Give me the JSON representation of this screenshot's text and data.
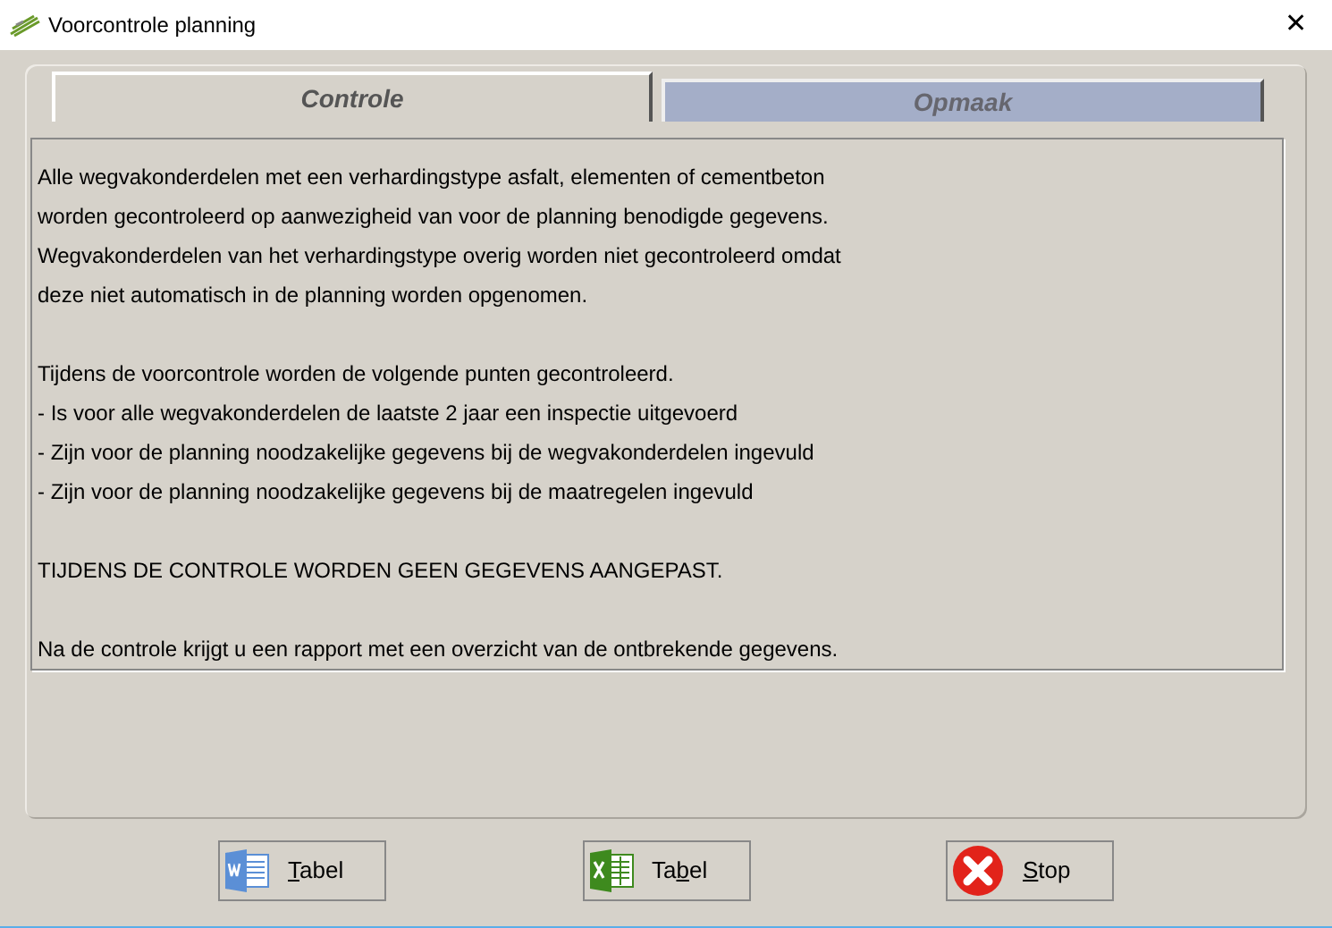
{
  "window": {
    "title": "Voorcontrole planning",
    "close": "✕"
  },
  "tabs": [
    {
      "label": "Controle",
      "selected": true
    },
    {
      "label": "Opmaak",
      "selected": false
    }
  ],
  "paragraphs": [
    [
      "Alle wegvakonderdelen met een verhardingstype asfalt, elementen of cementbeton",
      "worden gecontroleerd op aanwezigheid van voor de planning benodigde gegevens.",
      "Wegvakonderdelen van het verhardingstype overig worden niet gecontroleerd omdat",
      "deze niet automatisch in de planning worden opgenomen."
    ],
    [
      "Tijdens de voorcontrole worden de volgende punten gecontroleerd.",
      "- Is voor alle wegvakonderdelen de laatste 2 jaar een inspectie uitgevoerd",
      "- Zijn voor de planning noodzakelijke gegevens bij de wegvakonderdelen ingevuld",
      "- Zijn voor de planning noodzakelijke gegevens bij de maatregelen ingevuld"
    ],
    [
      "TIJDENS DE CONTROLE WORDEN GEEN GEGEVENS AANGEPAST."
    ],
    [
      "Na de controle krijgt u een rapport met een overzicht van de ontbrekende gegevens."
    ]
  ],
  "buttons": [
    {
      "kind": "word",
      "label_parts": [
        {
          "text": "T",
          "underlined": true
        },
        {
          "text": "abel",
          "underlined": false
        }
      ]
    },
    {
      "kind": "excel",
      "label_parts": [
        {
          "text": "Ta",
          "underlined": false
        },
        {
          "text": "b",
          "underlined": true
        },
        {
          "text": "el",
          "underlined": false
        }
      ]
    },
    {
      "kind": "stop",
      "label_parts": [
        {
          "text": "S",
          "underlined": true
        },
        {
          "text": "top",
          "underlined": false
        }
      ]
    }
  ]
}
